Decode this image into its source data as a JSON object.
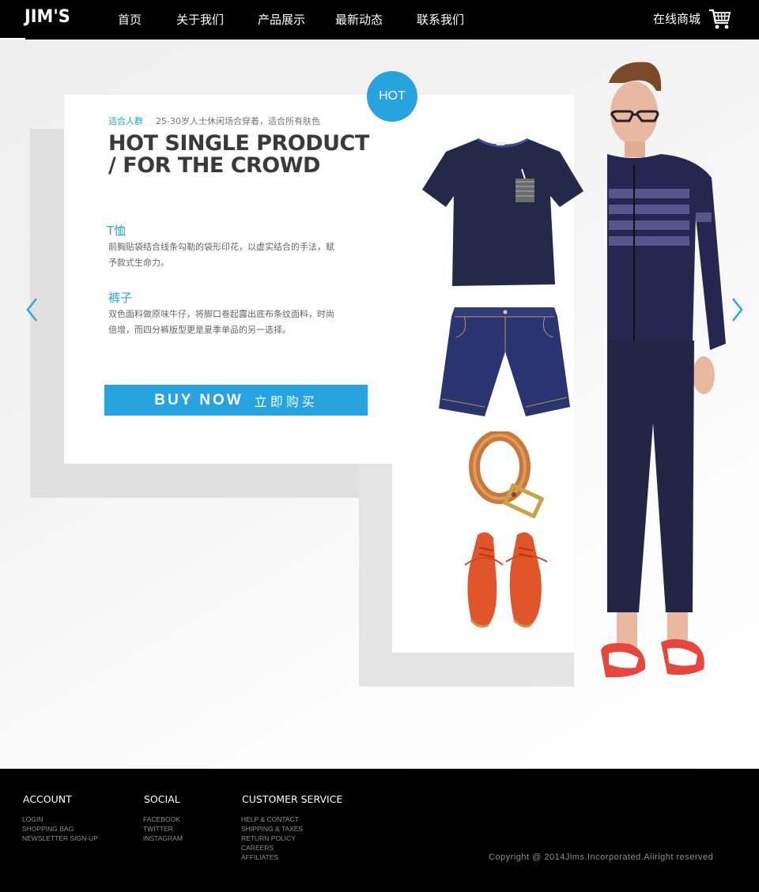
{
  "header": {
    "logo": "JIM'S",
    "nav": [
      "首页",
      "关于我们",
      "产品展示",
      "最新动态",
      "联系我们"
    ],
    "shop_link": "在线商城",
    "cart_icon": "shopping-cart-icon"
  },
  "hero": {
    "hot_badge": "HOT",
    "tag_label": "适合人群",
    "tag_desc": "25-30岁人士休闲场合穿着，适合所有肤色",
    "headline_line1": "HOT SINGLE PRODUCT",
    "headline_line2": "/ FOR THE CROWD",
    "items": [
      {
        "title": "T恤",
        "desc_line1": "前胸贴袋结合线条勾勒的袋形印花，以虚实结合的手法，赋",
        "desc_line2": "予款式生命力。"
      },
      {
        "title": "裤子",
        "desc_line1": "双色面料做原味牛仔，将脚口卷起露出底布条纹面料，时尚",
        "desc_line2": "倍增，而四分裤版型更是夏季单品的另一选择。"
      }
    ],
    "buy_en": "BUY NOW",
    "buy_cn": "立即购买",
    "prev_icon": "chevron-left-icon",
    "next_icon": "chevron-right-icon",
    "products": [
      "t-shirt",
      "denim-shorts",
      "leather-belt",
      "orange-boots"
    ]
  },
  "footer": {
    "account": {
      "heading": "ACCOUNT",
      "links": [
        "LOGIN",
        "SHOPPING BAG",
        "NEWSLETTER SIGN-UP"
      ]
    },
    "social": {
      "heading": "SOCIAL",
      "links": [
        "FACEBOOK",
        "TWITTER",
        "INSTAGRAM"
      ]
    },
    "service": {
      "heading": "CUSTOMER SERVICE",
      "links": [
        "HELP & CONTACT",
        "SHIPPING & TAXES",
        "RETURN POLICY",
        "CAREERS",
        "AFFILIATES"
      ]
    },
    "copyright": "Copyright @ 2014Jims.Incorporated.Aiiright reserved"
  },
  "colors": {
    "accent": "#27a4e0",
    "header_bg": "#000000",
    "footer_bg": "#000000",
    "headline": "#3a3a3a"
  }
}
